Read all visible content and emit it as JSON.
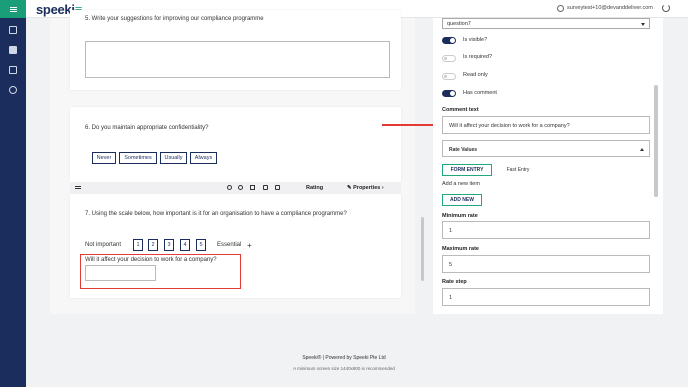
{
  "app": {
    "logo": "speeki",
    "user_email": "surveytest+10@devanddeliver.com"
  },
  "questions": {
    "q5": {
      "title": "5.  Write your suggestions for improving our compliance programme"
    },
    "q6": {
      "title": "6.  Do you maintain appropriate confidentiality?",
      "choices": [
        "Never",
        "Sometimes",
        "Usually",
        "Always"
      ]
    },
    "q7": {
      "title": "7.  Using the scale below, how important is it for an organisation to have a compliance programme?",
      "min_label": "Not important",
      "max_label": "Essential",
      "rates": [
        "1",
        "2",
        "3",
        "4",
        "5"
      ],
      "add": "+",
      "comment_label": "Will it affect your decision to work for a company?"
    }
  },
  "toolbar": {
    "rating": "Rating",
    "properties": "Properties"
  },
  "panel": {
    "name_value": "question7",
    "toggles": [
      {
        "label": "Is visible?",
        "on": true
      },
      {
        "label": "Is required?",
        "on": false
      },
      {
        "label": "Read only",
        "on": false
      },
      {
        "label": "Has comment",
        "on": true
      }
    ],
    "comment_text_label": "Comment text",
    "comment_text_value": "Will it affect your decision to work for a company?",
    "rate_values_label": "Rate Values",
    "tab_form_entry": "FORM ENTRY",
    "tab_fast_entry": "Fast Entry",
    "add_item_text": "Add a new item",
    "add_new": "ADD NEW",
    "min_rate_label": "Minimum rate",
    "min_rate_value": "1",
    "max_rate_label": "Maximum rate",
    "max_rate_value": "5",
    "rate_step_label": "Rate step",
    "rate_step_value": "1"
  },
  "footer": {
    "line1": "Speeki®  |  Powered by Speeki Pte Ltd",
    "line2": "A minimum screen size 1440x900 is recommended"
  },
  "colors": {
    "navy": "#1b2d5c",
    "green": "#1fa97d",
    "red": "#e53935"
  }
}
